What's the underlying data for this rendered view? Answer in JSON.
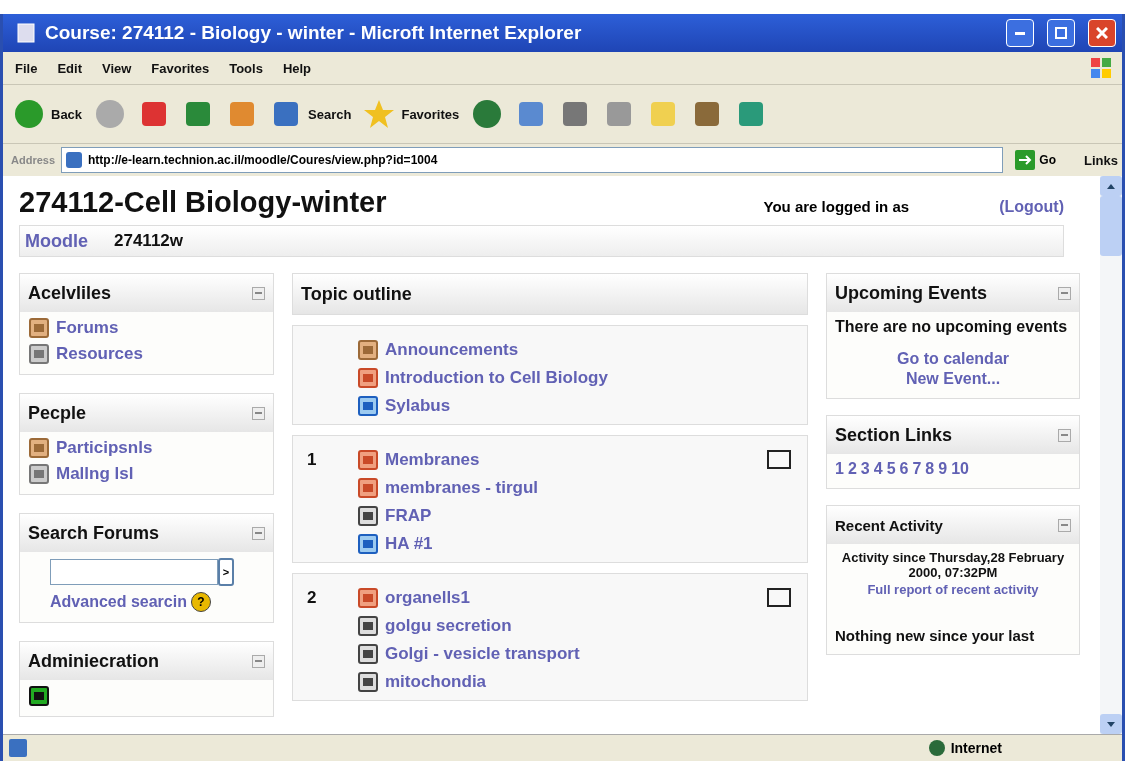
{
  "window": {
    "title": "Course: 274112 - Biology - winter - Microft Internet Explorer"
  },
  "menu": [
    "File",
    "Edit",
    "View",
    "Favorites",
    "Tools",
    "Help"
  ],
  "toolbar": [
    {
      "kind": "back",
      "label": "Back"
    },
    {
      "kind": "forward"
    },
    {
      "kind": "stop"
    },
    {
      "kind": "refresh"
    },
    {
      "kind": "home"
    },
    {
      "kind": "search",
      "label": "Search"
    },
    {
      "kind": "favorites",
      "label": "Favorites"
    },
    {
      "kind": "media"
    },
    {
      "kind": "mail"
    },
    {
      "kind": "print"
    },
    {
      "kind": "edit"
    },
    {
      "kind": "note"
    },
    {
      "kind": "research"
    },
    {
      "kind": "messenger"
    }
  ],
  "address": {
    "label": "Address",
    "value": "http://e-learn.technion.ac.il/moodle/Coures/view.php?id=1004",
    "go": "Go",
    "links": "Links"
  },
  "page": {
    "heading": "274112-Cell Biology-winter",
    "login_text": "You are logged in as",
    "logout": "(Logout)",
    "breadcrumb": [
      {
        "text": "Moodle",
        "link": true
      },
      {
        "text": "274112w",
        "link": false
      }
    ]
  },
  "left_blocks": [
    {
      "title": "Acelvliles",
      "items": [
        {
          "kind": "forum",
          "label": "Forums"
        },
        {
          "kind": "resource",
          "label": "Resources"
        }
      ]
    },
    {
      "title": "Pecple",
      "items": [
        {
          "kind": "forum",
          "label": "Participsnls"
        },
        {
          "kind": "resource",
          "label": "Mallng lsl"
        }
      ]
    },
    {
      "title": "Search Forums",
      "kind": "search",
      "link": "Advanced searcin",
      "button": ">",
      "help": "?"
    },
    {
      "title": "Adminiecration",
      "items": [
        {
          "kind": "admin"
        }
      ]
    }
  ],
  "topic_outline": {
    "title": "Topic outline",
    "sections": [
      {
        "items": [
          {
            "kind": "forum",
            "label": "Announcements"
          },
          {
            "kind": "doc",
            "label": "Introduction to Cell Biology"
          },
          {
            "kind": "web",
            "label": "Sylabus"
          }
        ]
      },
      {
        "number": "1",
        "checked": false,
        "items": [
          {
            "kind": "doc",
            "label": "Membranes"
          },
          {
            "kind": "doc",
            "label": "membranes - tirgul"
          },
          {
            "kind": "print",
            "label": "FRAP"
          },
          {
            "kind": "web",
            "label": "HA #1"
          }
        ]
      },
      {
        "number": "2",
        "checked": false,
        "items": [
          {
            "kind": "doc",
            "label": "organells1"
          },
          {
            "kind": "print",
            "label": "golgu secretion"
          },
          {
            "kind": "print",
            "label": "Golgi - vesicle transport"
          },
          {
            "kind": "print",
            "label": "mitochondia"
          }
        ]
      }
    ]
  },
  "right_blocks": [
    {
      "kind": "events",
      "title": "Upcoming Events",
      "text": "There are no upcoming events",
      "links": [
        "Go to calendar",
        "New Event..."
      ]
    },
    {
      "kind": "sections",
      "title": "Section Links",
      "links": [
        "1",
        "2",
        "3",
        "4",
        "5",
        "6",
        "7",
        "8",
        "9",
        "10"
      ]
    },
    {
      "kind": "activity",
      "title": "Recent Activity",
      "text": "Activity since Thursday,28 February 2000, 07:32PM",
      "link": "Full report of recent activity",
      "note": "Nothing new since your last"
    }
  ],
  "status_bar": {
    "zone": "Internet"
  }
}
